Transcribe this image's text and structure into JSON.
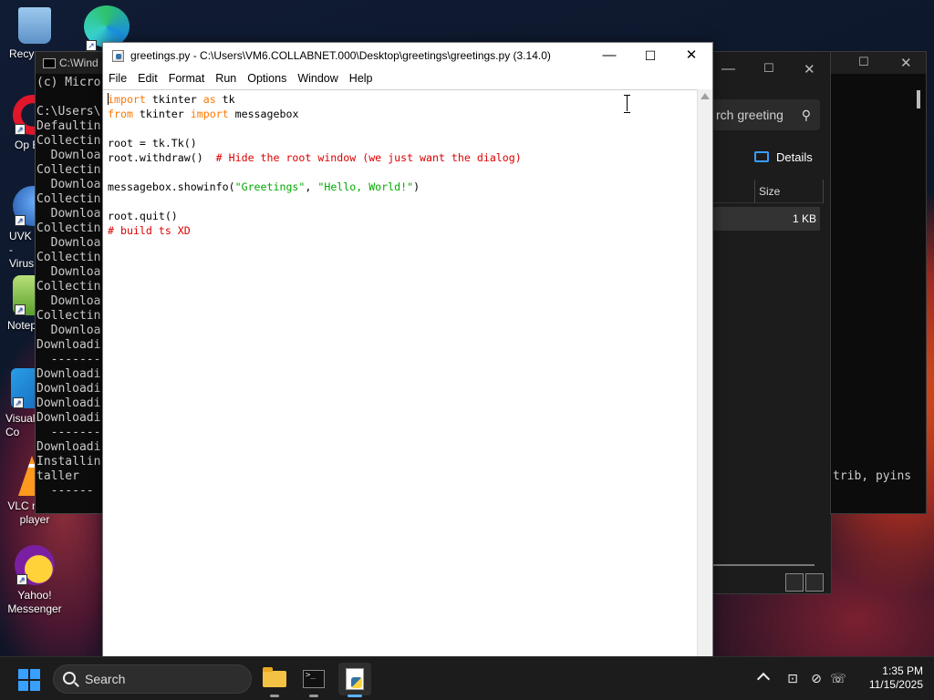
{
  "desktop": {
    "icons": [
      {
        "label": "Recyc"
      },
      {
        "label": "Op Brow"
      },
      {
        "label": "UVK - Virus"
      },
      {
        "label": "Notep"
      },
      {
        "label": "Visual Co"
      },
      {
        "label": "VLC media player"
      },
      {
        "label": "Yahoo! Messenger"
      }
    ]
  },
  "console_window": {
    "title": "C:\\Wind",
    "lines": [
      "(c) Micro",
      "",
      "C:\\Users\\",
      "Defaultin",
      "Collectin",
      "  Downloa",
      "Collectin",
      "  Downloa",
      "Collectin",
      "  Downloa",
      "Collectin",
      "  Downloa",
      "Collectin",
      "  Downloa",
      "Collectin",
      "  Downloa",
      "Collectin",
      "  Downloa",
      "Downloadi",
      "  -------",
      "Downloadi",
      "Downloadi",
      "Downloadi",
      "Downloadi",
      "  -------",
      "Downloadi",
      "Installin",
      "taller",
      "  ------"
    ]
  },
  "explorer_window": {
    "search_text": "rch greeting",
    "details_label": "Details",
    "size_header": "Size",
    "row_size": "1 KB"
  },
  "terminal_window": {
    "text": "trib, pyins"
  },
  "idle_window": {
    "title": "greetings.py - C:\\Users\\VM6.COLLABNET.000\\Desktop\\greetings\\greetings.py (3.14.0)",
    "menu": [
      "File",
      "Edit",
      "Format",
      "Run",
      "Options",
      "Window",
      "Help"
    ],
    "code": {
      "l1_kw1": "import",
      "l1_rest": " tkinter ",
      "l1_kw2": "as",
      "l1_end": " tk",
      "l2_kw1": "from",
      "l2_mid": " tkinter ",
      "l2_kw2": "import",
      "l2_end": " messagebox",
      "l4": "root = tk.Tk()",
      "l5_code": "root.withdraw()  ",
      "l5_comment": "# Hide the root window (we just want the dialog)",
      "l7_a": "messagebox.showinfo(",
      "l7_s1": "\"Greetings\"",
      "l7_b": ", ",
      "l7_s2": "\"Hello, World!\"",
      "l7_c": ")",
      "l9": "root.quit()",
      "l10_comment": "# build ts XD"
    }
  },
  "taskbar": {
    "search_label": "Search",
    "time": "1:35 PM",
    "date": "11/15/2025"
  },
  "colors": {
    "keyword": "#ff7700",
    "string": "#00aa00",
    "comment": "#dd0000"
  }
}
